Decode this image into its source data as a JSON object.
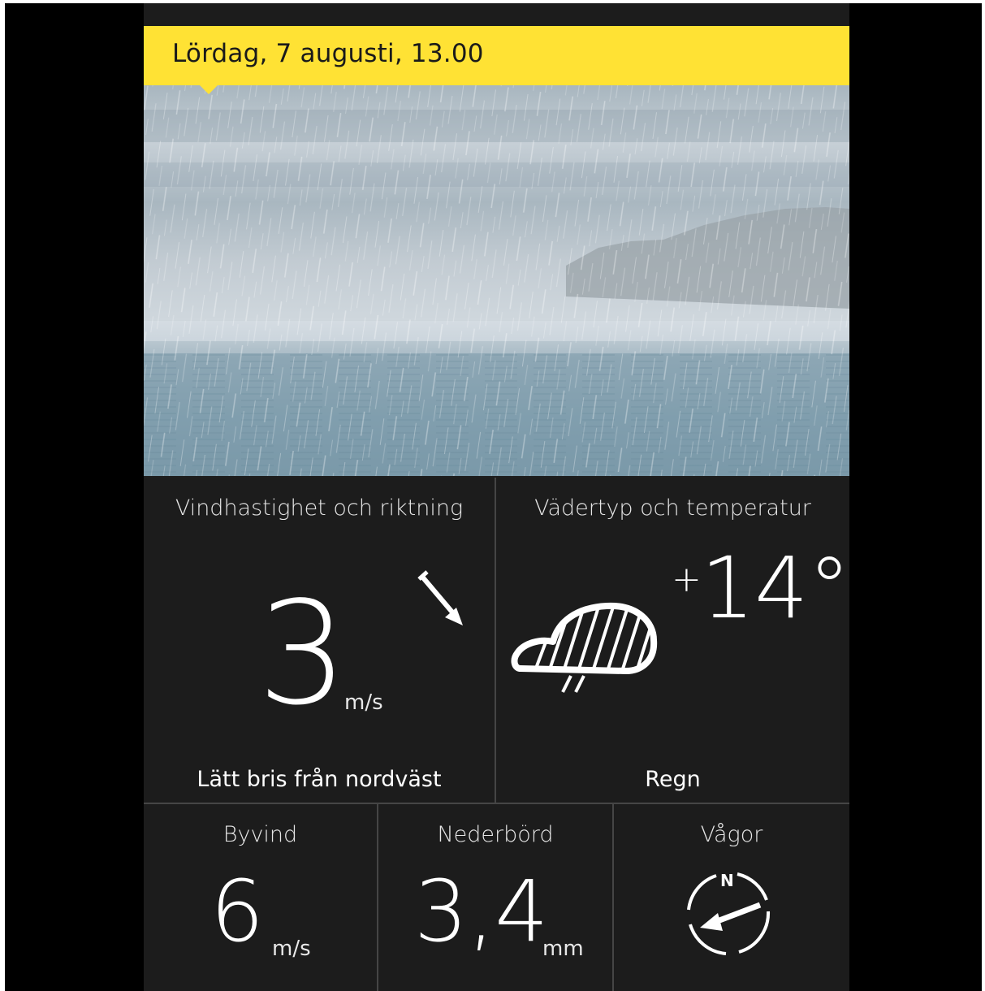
{
  "header": {
    "date_time": "Lördag, 7 augusti, 13.00"
  },
  "colors": {
    "accent_yellow": "#ffe234",
    "panel_bg": "#1c1c1c",
    "text_primary": "#ffffff"
  },
  "wind": {
    "title": "Vindhastighet och riktning",
    "speed": "3",
    "unit": "m/s",
    "description": "Lätt bris från nordväst",
    "direction_icon": "arrow-down-right-icon"
  },
  "weather": {
    "title": "Vädertyp och temperatur",
    "temperature_sign": "+",
    "temperature": "14°",
    "description": "Regn",
    "icon": "rain-cloud-icon"
  },
  "gust": {
    "title": "Byvind",
    "value": "6",
    "unit": "m/s"
  },
  "precipitation": {
    "title": "Nederbörd",
    "value": "3,4",
    "unit": "mm"
  },
  "waves": {
    "title": "Vågor",
    "compass_label": "N",
    "icon": "compass-arrow-icon"
  }
}
